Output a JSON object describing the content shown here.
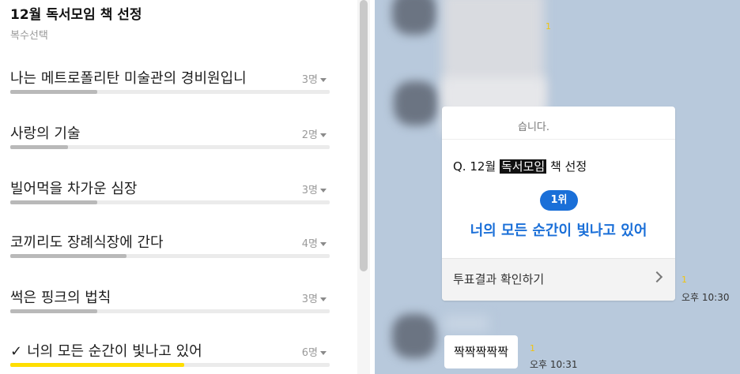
{
  "poll": {
    "title": "12월 독서모임 책 선정",
    "subtitle": "복수선택",
    "options": [
      {
        "label": "나는 메트로폴리탄 미술관의 경비원입니",
        "count": "3명",
        "votes": 3,
        "selected": false
      },
      {
        "label": "사랑의 기술",
        "count": "2명",
        "votes": 2,
        "selected": false
      },
      {
        "label": "빌어먹을 차가운 심장",
        "count": "3명",
        "votes": 3,
        "selected": false
      },
      {
        "label": "코끼리도 장례식장에 간다",
        "count": "4명",
        "votes": 4,
        "selected": false
      },
      {
        "label": "썩은 핑크의 법칙",
        "count": "3명",
        "votes": 3,
        "selected": false
      },
      {
        "label": "너의 모든 순간이 빛나고 있어",
        "count": "6명",
        "votes": 6,
        "selected": true
      }
    ],
    "check_glyph": "✓",
    "bar_color": "#b9b9b9",
    "winner_bar_color": "#ffde00"
  },
  "chat": {
    "background_color": "#b8c9dc",
    "result_card": {
      "header_fragment": "습니다.",
      "question_prefix": "Q. 12월 ",
      "question_highlight": "독서모임",
      "question_suffix": " 책 선정",
      "rank_label": "1위",
      "winner": "너의 모든 순간이 빛나고 있어",
      "footer_label": "투표결과 확인하기",
      "accent_color": "#1a6fd8"
    },
    "unread_1": "1",
    "unread_2": "1",
    "unread_3": "1",
    "time_1": "오후 10:30",
    "time_2": "오후 10:31",
    "last_message": "짝짝짝짝짝"
  }
}
